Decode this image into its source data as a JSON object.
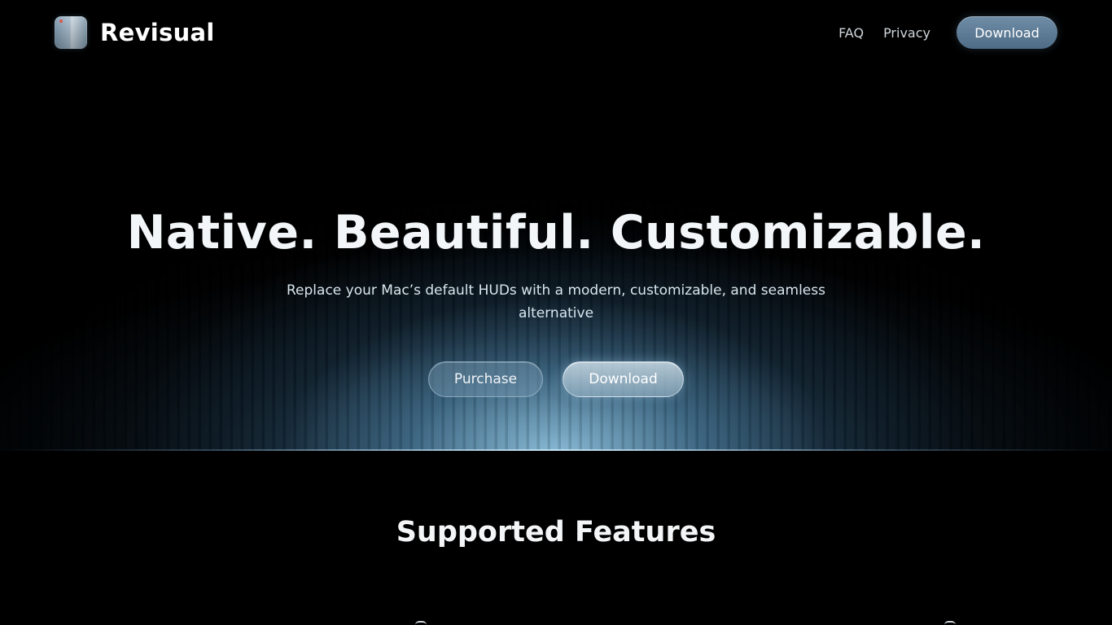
{
  "header": {
    "brand_name": "Revisual",
    "nav": {
      "faq": "FAQ",
      "privacy": "Privacy",
      "download": "Download"
    }
  },
  "hero": {
    "headline": "Native. Beautiful. Customizable.",
    "subheadline": "Replace your Mac’s default HUDs with a modern, customizable, and seamless alternative",
    "purchase_label": "Purchase",
    "download_label": "Download"
  },
  "features": {
    "title": "Supported Features"
  },
  "colors": {
    "background": "#000000",
    "accent": "#5b7a94",
    "glow": "#96cdeb"
  },
  "icons": {
    "app_icon": "revisual-app-icon"
  }
}
